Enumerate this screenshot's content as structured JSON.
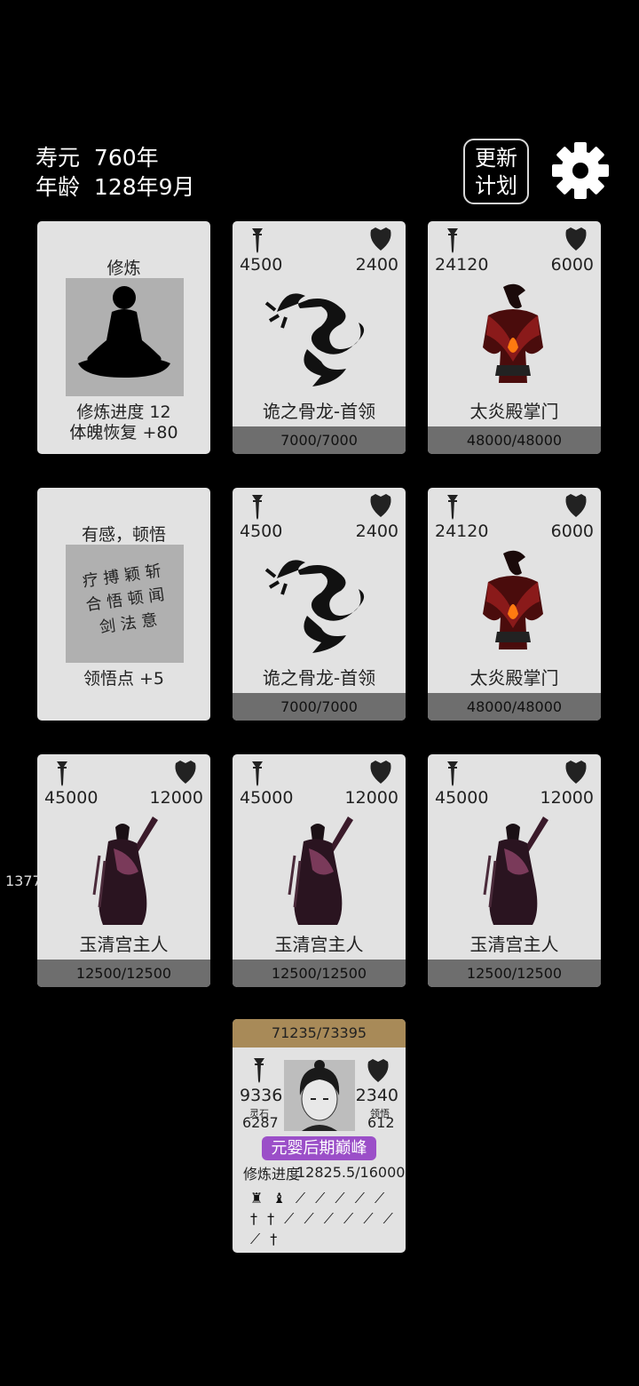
{
  "header": {
    "lifespan_label": "寿元",
    "lifespan_value": "760年",
    "age_label": "年龄",
    "age_value": "128年9月",
    "update_label_1": "更新",
    "update_label_2": "计划"
  },
  "side_number": "1377",
  "cultivate": {
    "title": "修炼",
    "progress": "修炼进度  12",
    "recover": "体魄恢复  +80"
  },
  "insight": {
    "title": "有感，顿悟",
    "points": "领悟点  +5",
    "glyphs": "疗 搏 颖 斩 合 悟 顿 闻 剑 法 意"
  },
  "enemies": [
    {
      "name": "诡之骨龙-首领",
      "atk": "4500",
      "def": "2400",
      "hp": "7000/7000",
      "icon": "dragon"
    },
    {
      "name": "太炎殿掌门",
      "atk": "24120",
      "def": "6000",
      "hp": "48000/48000",
      "icon": "flame-demon"
    },
    {
      "name": "诡之骨龙-首领",
      "atk": "4500",
      "def": "2400",
      "hp": "7000/7000",
      "icon": "dragon"
    },
    {
      "name": "太炎殿掌门",
      "atk": "24120",
      "def": "6000",
      "hp": "48000/48000",
      "icon": "flame-demon"
    },
    {
      "name": "玉清宫主人",
      "atk": "45000",
      "def": "12000",
      "hp": "12500/12500",
      "icon": "palace-lady"
    },
    {
      "name": "玉清宫主人",
      "atk": "45000",
      "def": "12000",
      "hp": "12500/12500",
      "icon": "palace-lady"
    },
    {
      "name": "玉清宫主人",
      "atk": "45000",
      "def": "12000",
      "hp": "12500/12500",
      "icon": "palace-lady"
    }
  ],
  "player": {
    "hp": "71235/73395",
    "atk": "9336",
    "def": "2340",
    "stone_label": "灵石",
    "stone_value": "6287",
    "insight_label": "领悟",
    "insight_value": "612",
    "realm": "元婴后期巅峰",
    "progress_label": "修炼进度",
    "progress_value": "12825.5/16000",
    "weapons": "♜ ♝ ⟋ ⟋ ⟋ ⟋ ⟋ † † ⟋ ⟋ ⟋ ⟋ ⟋ ⟋ ⟋ †"
  },
  "colors": {
    "card": "#e2e2e2",
    "hp_bar": "#6e6e6e",
    "player_bar": "#a88a58",
    "realm": "#9b4fc8"
  }
}
